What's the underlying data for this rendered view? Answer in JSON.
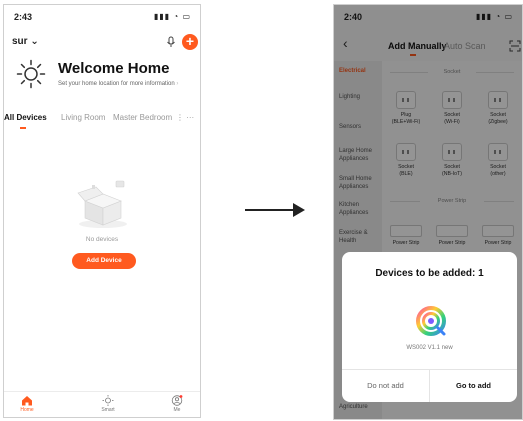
{
  "left_phone": {
    "status_time": "2:43",
    "home_name": "sur",
    "welcome_title": "Welcome Home",
    "welcome_subtitle": "Set your home location for more information",
    "room_tabs": [
      {
        "label": "All Devices"
      },
      {
        "label": "Living Room"
      },
      {
        "label": "Master Bedroom"
      }
    ],
    "more_tabs": "⋮ ···",
    "empty_message": "No devices",
    "add_device_label": "Add Device",
    "tabbar": [
      {
        "label": "Home",
        "icon": "home-icon"
      },
      {
        "label": "Smart",
        "icon": "sun-icon"
      },
      {
        "label": "Me",
        "icon": "user-icon"
      }
    ]
  },
  "right_phone": {
    "status_time": "2:40",
    "tabs": {
      "manual": "Add Manually",
      "auto": "Auto Scan"
    },
    "categories": [
      "Electrical",
      "Lighting",
      "Sensors",
      "Large Home Appliances",
      "Small Home Appliances",
      "Kitchen Appliances",
      "Exercise & Health",
      "Agriculture"
    ],
    "socket_section": "Socket",
    "sockets": [
      {
        "name": "Plug",
        "sub": "(BLE+Wi-Fi)"
      },
      {
        "name": "Socket",
        "sub": "(Wi-Fi)"
      },
      {
        "name": "Socket",
        "sub": "(Zigbee)"
      },
      {
        "name": "Socket",
        "sub": "(BLE)"
      },
      {
        "name": "Socket",
        "sub": "(NB-IoT)"
      },
      {
        "name": "Socket",
        "sub": "(other)"
      }
    ],
    "strip_section": "Power Strip",
    "strips": [
      "Power Strip",
      "Power Strip",
      "Power Strip"
    ],
    "dialog": {
      "title": "Devices to be added: 1",
      "device_name": "WS002 V1.1 new",
      "cancel_label": "Do not add",
      "confirm_label": "Go to add"
    }
  },
  "colors": {
    "accent": "#ff5a1f"
  }
}
